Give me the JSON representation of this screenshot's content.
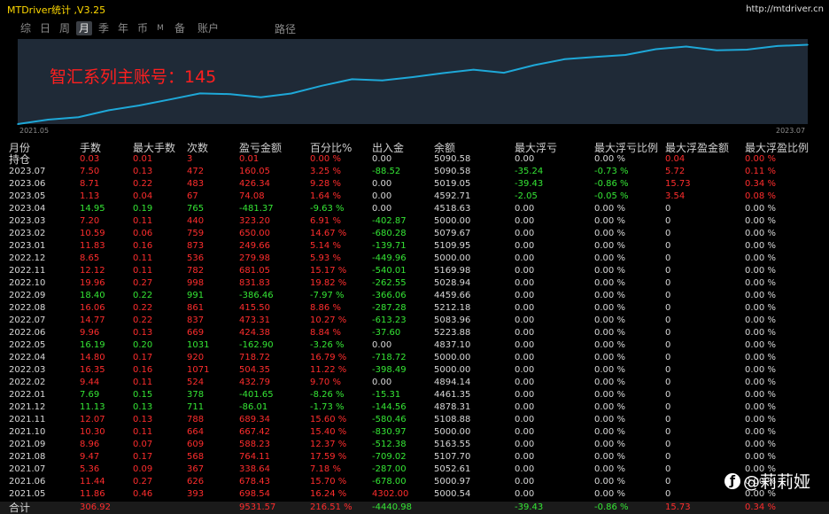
{
  "title": "MTDriver统计 ,V3.25",
  "site_url": "http://mtdriver.cn",
  "tabs": [
    {
      "label": "综",
      "active": false
    },
    {
      "label": "日",
      "active": false
    },
    {
      "label": "周",
      "active": false
    },
    {
      "label": "月",
      "active": true
    },
    {
      "label": "季",
      "active": false
    },
    {
      "label": "年",
      "active": false
    },
    {
      "label": "币",
      "active": false
    },
    {
      "label": "M",
      "active": false
    },
    {
      "label": "备",
      "active": false
    },
    {
      "label": "账户",
      "active": false
    }
  ],
  "path_label": "路径",
  "account_label": "智汇系列主账号：145",
  "chart_data": {
    "type": "line",
    "x_start_label": "2021.05",
    "x_end_label": "2023.07",
    "line_color": "#1ea8d8",
    "x": [
      "2021.05",
      "2021.06",
      "2021.07",
      "2021.08",
      "2021.09",
      "2021.10",
      "2021.11",
      "2021.12",
      "2022.01",
      "2022.02",
      "2022.03",
      "2022.04",
      "2022.05",
      "2022.06",
      "2022.07",
      "2022.08",
      "2022.09",
      "2022.10",
      "2022.11",
      "2022.12",
      "2023.01",
      "2023.02",
      "2023.03",
      "2023.04",
      "2023.05",
      "2023.06",
      "2023.07"
    ],
    "y": [
      5000.54,
      5000.97,
      5052.61,
      5107.7,
      5163.55,
      5000.0,
      5108.88,
      4878.31,
      4461.35,
      4894.14,
      5000.0,
      5000.0,
      4837.1,
      5223.88,
      5083.96,
      5212.18,
      4459.66,
      5028.94,
      5169.98,
      5000.0,
      5109.95,
      5079.67,
      5000.0,
      4518.63,
      4592.71,
      5019.05,
      5090.58
    ],
    "equity": [
      100,
      111.4,
      117.8,
      135.5,
      147.9,
      163.3,
      178.9,
      177.2,
      169.0,
      178.7,
      198.7,
      215.5,
      212.2,
      221.0,
      231.3,
      240.1,
      232.1,
      251.9,
      267.1,
      273.0,
      278.1,
      292.8,
      299.7,
      290.1,
      291.7,
      301.0,
      304.3
    ]
  },
  "table": {
    "headers": [
      "月份",
      "手数",
      "最大手数",
      "次数",
      "盈亏金额",
      "百分比%",
      "出入金",
      "余额",
      "最大浮亏",
      "最大浮亏比例",
      "最大浮盈金额",
      "最大浮盈比例"
    ],
    "rows": [
      {
        "c": [
          "持仓",
          "0.03",
          "0.01",
          "3",
          "0.01",
          "0.00 %",
          "0.00",
          "5090.58",
          "0.00",
          "0.00 %",
          "0.04",
          "0.00 %"
        ],
        "s": [
          "plain",
          "pos",
          "pos",
          "pos",
          "pos",
          "pos",
          "plain",
          "plain",
          "plain",
          "plain",
          "pos",
          "pos"
        ]
      },
      {
        "c": [
          "2023.07",
          "7.50",
          "0.13",
          "472",
          "160.05",
          "3.25 %",
          "-88.52",
          "5090.58",
          "-35.24",
          "-0.73 %",
          "5.72",
          "0.11 %"
        ],
        "s": [
          "plain",
          "pos",
          "pos",
          "pos",
          "pos",
          "pos",
          "neg",
          "plain",
          "neg",
          "neg",
          "pos",
          "pos"
        ]
      },
      {
        "c": [
          "2023.06",
          "8.71",
          "0.22",
          "483",
          "426.34",
          "9.28 %",
          "0.00",
          "5019.05",
          "-39.43",
          "-0.86 %",
          "15.73",
          "0.34 %"
        ],
        "s": [
          "plain",
          "pos",
          "pos",
          "pos",
          "pos",
          "pos",
          "plain",
          "plain",
          "neg",
          "neg",
          "pos",
          "pos"
        ]
      },
      {
        "c": [
          "2023.05",
          "1.13",
          "0.04",
          "67",
          "74.08",
          "1.64 %",
          "0.00",
          "4592.71",
          "-2.05",
          "-0.05 %",
          "3.54",
          "0.08 %"
        ],
        "s": [
          "plain",
          "pos",
          "pos",
          "pos",
          "pos",
          "pos",
          "plain",
          "plain",
          "neg",
          "neg",
          "pos",
          "pos"
        ]
      },
      {
        "c": [
          "2023.04",
          "14.95",
          "0.19",
          "765",
          "-481.37",
          "-9.63 %",
          "0.00",
          "4518.63",
          "0.00",
          "0.00 %",
          "0",
          "0.00 %"
        ],
        "s": [
          "plain",
          "neg",
          "neg",
          "neg",
          "neg",
          "neg",
          "plain",
          "plain",
          "plain",
          "plain",
          "plain",
          "plain"
        ]
      },
      {
        "c": [
          "2023.03",
          "7.20",
          "0.11",
          "440",
          "323.20",
          "6.91 %",
          "-402.87",
          "5000.00",
          "0.00",
          "0.00 %",
          "0",
          "0.00 %"
        ],
        "s": [
          "plain",
          "pos",
          "pos",
          "pos",
          "pos",
          "pos",
          "neg",
          "plain",
          "plain",
          "plain",
          "plain",
          "plain"
        ]
      },
      {
        "c": [
          "2023.02",
          "10.59",
          "0.06",
          "759",
          "650.00",
          "14.67 %",
          "-680.28",
          "5079.67",
          "0.00",
          "0.00 %",
          "0",
          "0.00 %"
        ],
        "s": [
          "plain",
          "pos",
          "pos",
          "pos",
          "pos",
          "pos",
          "neg",
          "plain",
          "plain",
          "plain",
          "plain",
          "plain"
        ]
      },
      {
        "c": [
          "2023.01",
          "11.83",
          "0.16",
          "873",
          "249.66",
          "5.14 %",
          "-139.71",
          "5109.95",
          "0.00",
          "0.00 %",
          "0",
          "0.00 %"
        ],
        "s": [
          "plain",
          "pos",
          "pos",
          "pos",
          "pos",
          "pos",
          "neg",
          "plain",
          "plain",
          "plain",
          "plain",
          "plain"
        ]
      },
      {
        "c": [
          "2022.12",
          "8.65",
          "0.11",
          "536",
          "279.98",
          "5.93 %",
          "-449.96",
          "5000.00",
          "0.00",
          "0.00 %",
          "0",
          "0.00 %"
        ],
        "s": [
          "plain",
          "pos",
          "pos",
          "pos",
          "pos",
          "pos",
          "neg",
          "plain",
          "plain",
          "plain",
          "plain",
          "plain"
        ]
      },
      {
        "c": [
          "2022.11",
          "12.12",
          "0.11",
          "782",
          "681.05",
          "15.17 %",
          "-540.01",
          "5169.98",
          "0.00",
          "0.00 %",
          "0",
          "0.00 %"
        ],
        "s": [
          "plain",
          "pos",
          "pos",
          "pos",
          "pos",
          "pos",
          "neg",
          "plain",
          "plain",
          "plain",
          "plain",
          "plain"
        ]
      },
      {
        "c": [
          "2022.10",
          "19.96",
          "0.27",
          "998",
          "831.83",
          "19.82 %",
          "-262.55",
          "5028.94",
          "0.00",
          "0.00 %",
          "0",
          "0.00 %"
        ],
        "s": [
          "plain",
          "pos",
          "pos",
          "pos",
          "pos",
          "pos",
          "neg",
          "plain",
          "plain",
          "plain",
          "plain",
          "plain"
        ]
      },
      {
        "c": [
          "2022.09",
          "18.40",
          "0.22",
          "991",
          "-386.46",
          "-7.97 %",
          "-366.06",
          "4459.66",
          "0.00",
          "0.00 %",
          "0",
          "0.00 %"
        ],
        "s": [
          "plain",
          "neg",
          "neg",
          "neg",
          "neg",
          "neg",
          "neg",
          "plain",
          "plain",
          "plain",
          "plain",
          "plain"
        ]
      },
      {
        "c": [
          "2022.08",
          "16.06",
          "0.22",
          "861",
          "415.50",
          "8.86 %",
          "-287.28",
          "5212.18",
          "0.00",
          "0.00 %",
          "0",
          "0.00 %"
        ],
        "s": [
          "plain",
          "pos",
          "pos",
          "pos",
          "pos",
          "pos",
          "neg",
          "plain",
          "plain",
          "plain",
          "plain",
          "plain"
        ]
      },
      {
        "c": [
          "2022.07",
          "14.77",
          "0.22",
          "837",
          "473.31",
          "10.27 %",
          "-613.23",
          "5083.96",
          "0.00",
          "0.00 %",
          "0",
          "0.00 %"
        ],
        "s": [
          "plain",
          "pos",
          "pos",
          "pos",
          "pos",
          "pos",
          "neg",
          "plain",
          "plain",
          "plain",
          "plain",
          "plain"
        ]
      },
      {
        "c": [
          "2022.06",
          "9.96",
          "0.13",
          "669",
          "424.38",
          "8.84 %",
          "-37.60",
          "5223.88",
          "0.00",
          "0.00 %",
          "0",
          "0.00 %"
        ],
        "s": [
          "plain",
          "pos",
          "pos",
          "pos",
          "pos",
          "pos",
          "neg",
          "plain",
          "plain",
          "plain",
          "plain",
          "plain"
        ]
      },
      {
        "c": [
          "2022.05",
          "16.19",
          "0.20",
          "1031",
          "-162.90",
          "-3.26 %",
          "0.00",
          "4837.10",
          "0.00",
          "0.00 %",
          "0",
          "0.00 %"
        ],
        "s": [
          "plain",
          "neg",
          "neg",
          "neg",
          "neg",
          "neg",
          "plain",
          "plain",
          "plain",
          "plain",
          "plain",
          "plain"
        ]
      },
      {
        "c": [
          "2022.04",
          "14.80",
          "0.17",
          "920",
          "718.72",
          "16.79 %",
          "-718.72",
          "5000.00",
          "0.00",
          "0.00 %",
          "0",
          "0.00 %"
        ],
        "s": [
          "plain",
          "pos",
          "pos",
          "pos",
          "pos",
          "pos",
          "neg",
          "plain",
          "plain",
          "plain",
          "plain",
          "plain"
        ]
      },
      {
        "c": [
          "2022.03",
          "16.35",
          "0.16",
          "1071",
          "504.35",
          "11.22 %",
          "-398.49",
          "5000.00",
          "0.00",
          "0.00 %",
          "0",
          "0.00 %"
        ],
        "s": [
          "plain",
          "pos",
          "pos",
          "pos",
          "pos",
          "pos",
          "neg",
          "plain",
          "plain",
          "plain",
          "plain",
          "plain"
        ]
      },
      {
        "c": [
          "2022.02",
          "9.44",
          "0.11",
          "524",
          "432.79",
          "9.70 %",
          "0.00",
          "4894.14",
          "0.00",
          "0.00 %",
          "0",
          "0.00 %"
        ],
        "s": [
          "plain",
          "pos",
          "pos",
          "pos",
          "pos",
          "pos",
          "plain",
          "plain",
          "plain",
          "plain",
          "plain",
          "plain"
        ]
      },
      {
        "c": [
          "2022.01",
          "7.69",
          "0.15",
          "378",
          "-401.65",
          "-8.26 %",
          "-15.31",
          "4461.35",
          "0.00",
          "0.00 %",
          "0",
          "0.00 %"
        ],
        "s": [
          "plain",
          "neg",
          "neg",
          "neg",
          "neg",
          "neg",
          "neg",
          "plain",
          "plain",
          "plain",
          "plain",
          "plain"
        ]
      },
      {
        "c": [
          "2021.12",
          "11.13",
          "0.13",
          "711",
          "-86.01",
          "-1.73 %",
          "-144.56",
          "4878.31",
          "0.00",
          "0.00 %",
          "0",
          "0.00 %"
        ],
        "s": [
          "plain",
          "neg",
          "neg",
          "neg",
          "neg",
          "neg",
          "neg",
          "plain",
          "plain",
          "plain",
          "plain",
          "plain"
        ]
      },
      {
        "c": [
          "2021.11",
          "12.07",
          "0.13",
          "788",
          "689.34",
          "15.60 %",
          "-580.46",
          "5108.88",
          "0.00",
          "0.00 %",
          "0",
          "0.00 %"
        ],
        "s": [
          "plain",
          "pos",
          "pos",
          "pos",
          "pos",
          "pos",
          "neg",
          "plain",
          "plain",
          "plain",
          "plain",
          "plain"
        ]
      },
      {
        "c": [
          "2021.10",
          "10.30",
          "0.11",
          "664",
          "667.42",
          "15.40 %",
          "-830.97",
          "5000.00",
          "0.00",
          "0.00 %",
          "0",
          "0.00 %"
        ],
        "s": [
          "plain",
          "pos",
          "pos",
          "pos",
          "pos",
          "pos",
          "neg",
          "plain",
          "plain",
          "plain",
          "plain",
          "plain"
        ]
      },
      {
        "c": [
          "2021.09",
          "8.96",
          "0.07",
          "609",
          "588.23",
          "12.37 %",
          "-512.38",
          "5163.55",
          "0.00",
          "0.00 %",
          "0",
          "0.00 %"
        ],
        "s": [
          "plain",
          "pos",
          "pos",
          "pos",
          "pos",
          "pos",
          "neg",
          "plain",
          "plain",
          "plain",
          "plain",
          "plain"
        ]
      },
      {
        "c": [
          "2021.08",
          "9.47",
          "0.17",
          "568",
          "764.11",
          "17.59 %",
          "-709.02",
          "5107.70",
          "0.00",
          "0.00 %",
          "0",
          "0.00 %"
        ],
        "s": [
          "plain",
          "pos",
          "pos",
          "pos",
          "pos",
          "pos",
          "neg",
          "plain",
          "plain",
          "plain",
          "plain",
          "plain"
        ]
      },
      {
        "c": [
          "2021.07",
          "5.36",
          "0.09",
          "367",
          "338.64",
          "7.18 %",
          "-287.00",
          "5052.61",
          "0.00",
          "0.00 %",
          "0",
          "0.00 %"
        ],
        "s": [
          "plain",
          "pos",
          "pos",
          "pos",
          "pos",
          "pos",
          "neg",
          "plain",
          "plain",
          "plain",
          "plain",
          "plain"
        ]
      },
      {
        "c": [
          "2021.06",
          "11.44",
          "0.27",
          "626",
          "678.43",
          "15.70 %",
          "-678.00",
          "5000.97",
          "0.00",
          "0.00 %",
          "0",
          "0.00 %"
        ],
        "s": [
          "plain",
          "pos",
          "pos",
          "pos",
          "pos",
          "pos",
          "neg",
          "plain",
          "plain",
          "plain",
          "plain",
          "plain"
        ]
      },
      {
        "c": [
          "2021.05",
          "11.86",
          "0.46",
          "393",
          "698.54",
          "16.24 %",
          "4302.00",
          "5000.54",
          "0.00",
          "0.00 %",
          "0",
          "0.00 %"
        ],
        "s": [
          "plain",
          "pos",
          "pos",
          "pos",
          "pos",
          "pos",
          "pos",
          "plain",
          "plain",
          "plain",
          "plain",
          "plain"
        ]
      }
    ],
    "total": {
      "c": [
        "合计",
        "306.92",
        "",
        "",
        "9531.57",
        "216.51 %",
        "-4440.98",
        "",
        "-39.43",
        "-0.86 %",
        "15.73",
        "0.34 %"
      ],
      "s": [
        "plain",
        "pos",
        "pos",
        "pos",
        "pos",
        "pos",
        "neg",
        "plain",
        "neg",
        "neg",
        "pos",
        "pos"
      ]
    }
  },
  "watermark": {
    "icon": "ƒ",
    "text": "@莉莉娅"
  }
}
